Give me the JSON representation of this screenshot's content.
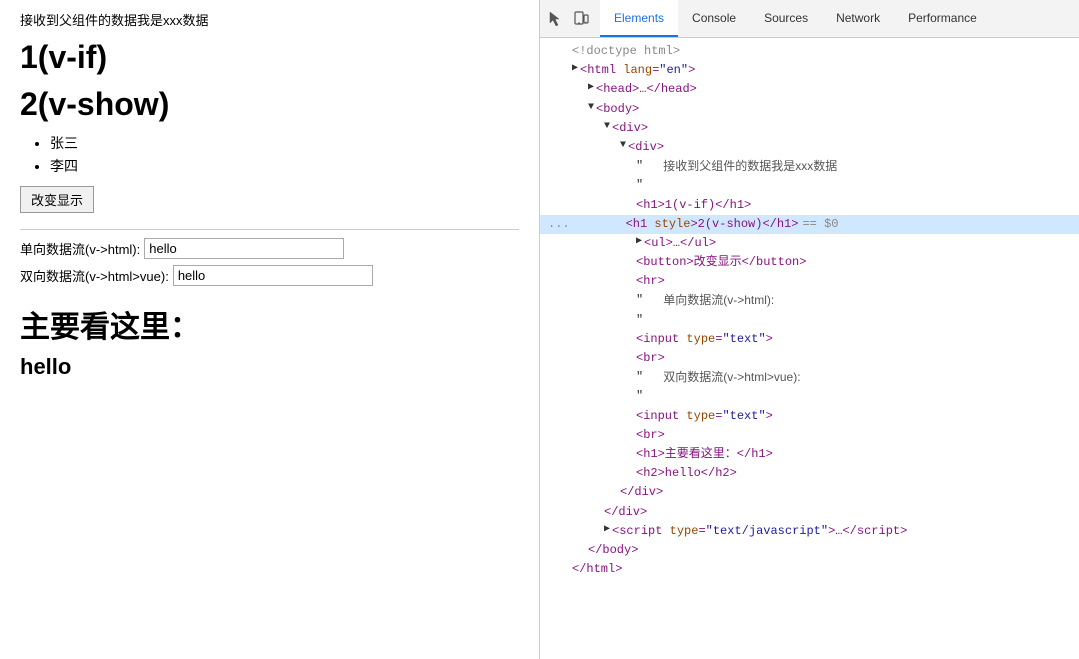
{
  "left": {
    "top_text": "接收到父组件的数据我是xxx数据",
    "h1_vif": "1(v-if)",
    "h1_vshow": "2(v-show)",
    "list_items": [
      "张三",
      "李四"
    ],
    "btn_label": "改变显示",
    "input1_label": "单向数据流(v->html):",
    "input1_value": "hello",
    "input2_label": "双向数据流(v->html>vue):",
    "input2_value": "hello",
    "main_title": "主要看这里：",
    "hello": "hello"
  },
  "devtools": {
    "tabs": [
      "Elements",
      "Console",
      "Sources",
      "Network",
      "Performance"
    ],
    "active_tab": "Elements",
    "icons": [
      "cursor-icon",
      "device-icon"
    ],
    "html_lines": [
      {
        "indent": 0,
        "content": "<!doctype html>",
        "type": "comment"
      },
      {
        "indent": 0,
        "content": "<html lang=\"en\">",
        "type": "tag-open",
        "triangle": "▶"
      },
      {
        "indent": 1,
        "content": "<head>…</head>",
        "type": "collapsed"
      },
      {
        "indent": 0,
        "content": "<body>",
        "type": "tag-open",
        "triangle": "▼"
      },
      {
        "indent": 1,
        "content": "<div>",
        "type": "tag-open",
        "triangle": "▼"
      },
      {
        "indent": 2,
        "content": "<div>",
        "type": "tag-open",
        "triangle": "▼"
      },
      {
        "indent": 3,
        "content": "\"",
        "type": "text"
      },
      {
        "indent": 3,
        "content": "side_text_1",
        "type": "side"
      },
      {
        "indent": 3,
        "content": "\"",
        "type": "text"
      },
      {
        "indent": 3,
        "content": "<h1>1(v-if)</h1>",
        "type": "tag-inline"
      },
      {
        "indent": 3,
        "content": "<h1 style>2(v-show)</h1>  == $0",
        "type": "tag-selected"
      },
      {
        "indent": 3,
        "content": "<ul>…</ul>",
        "type": "collapsed",
        "triangle": "▶"
      },
      {
        "indent": 3,
        "content": "<button>改变显示</button>",
        "type": "tag-inline"
      },
      {
        "indent": 3,
        "content": "<hr>",
        "type": "tag-inline"
      },
      {
        "indent": 3,
        "content": "\"",
        "type": "text"
      },
      {
        "indent": 3,
        "content": "side_text_2",
        "type": "side"
      },
      {
        "indent": 3,
        "content": "\"",
        "type": "text"
      },
      {
        "indent": 3,
        "content": "<input type=\"text\">",
        "type": "tag-inline"
      },
      {
        "indent": 3,
        "content": "<br>",
        "type": "tag-inline"
      },
      {
        "indent": 3,
        "content": "\"",
        "type": "text"
      },
      {
        "indent": 3,
        "content": "side_text_3",
        "type": "side"
      },
      {
        "indent": 3,
        "content": "\"",
        "type": "text"
      },
      {
        "indent": 3,
        "content": "<input type=\"text\">",
        "type": "tag-inline"
      },
      {
        "indent": 3,
        "content": "<br>",
        "type": "tag-inline"
      },
      {
        "indent": 3,
        "content": "<h1>主要看这里：</h1>",
        "type": "tag-inline"
      },
      {
        "indent": 3,
        "content": "<h2>hello</h2>",
        "type": "tag-inline"
      },
      {
        "indent": 2,
        "content": "</div>",
        "type": "tag-close"
      },
      {
        "indent": 1,
        "content": "</div>",
        "type": "tag-close"
      },
      {
        "indent": 1,
        "content": "<script type=\"text/javascript\">…<\\/script>",
        "type": "collapsed",
        "triangle": "▶"
      },
      {
        "indent": 0,
        "content": "</body>",
        "type": "tag-close"
      },
      {
        "indent": 0,
        "content": "</html>",
        "type": "tag-close"
      }
    ],
    "side_texts": {
      "side_text_1": "接收到父组件的数据我是xxx数据",
      "side_text_2": "单向数据流(v->html):",
      "side_text_3": "双向数据流(v->html>vue):"
    }
  }
}
